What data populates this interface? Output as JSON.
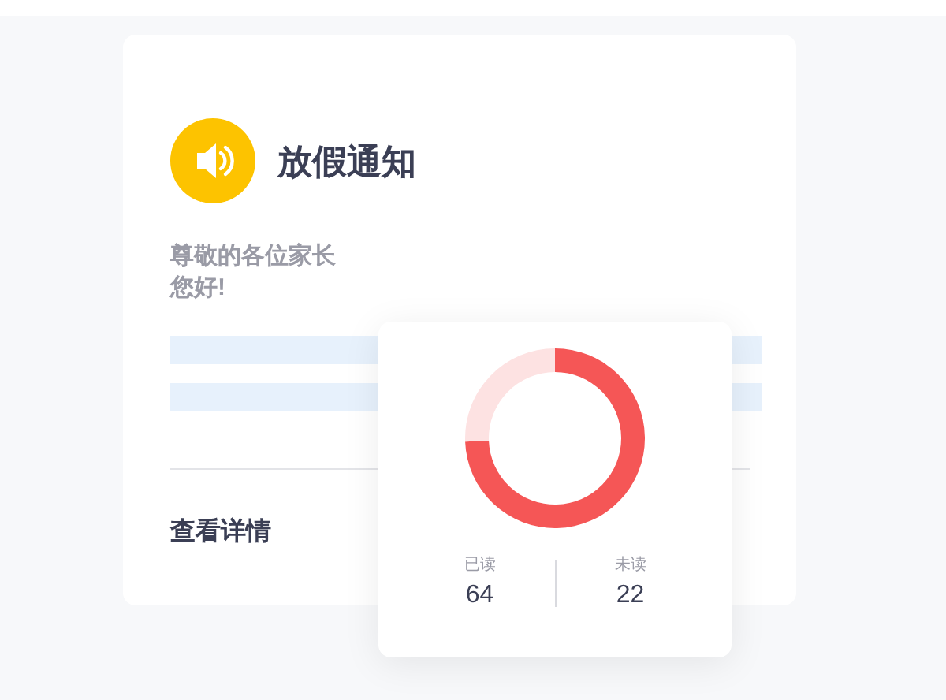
{
  "notice": {
    "title": "放假通知",
    "greeting_lines": [
      "尊敬的各位家长",
      "您好!"
    ],
    "link": "查看详情"
  },
  "read_stats": {
    "stats": [
      {
        "label": "已读",
        "value": "64"
      },
      {
        "label": "未读",
        "value": "22"
      }
    ]
  }
}
